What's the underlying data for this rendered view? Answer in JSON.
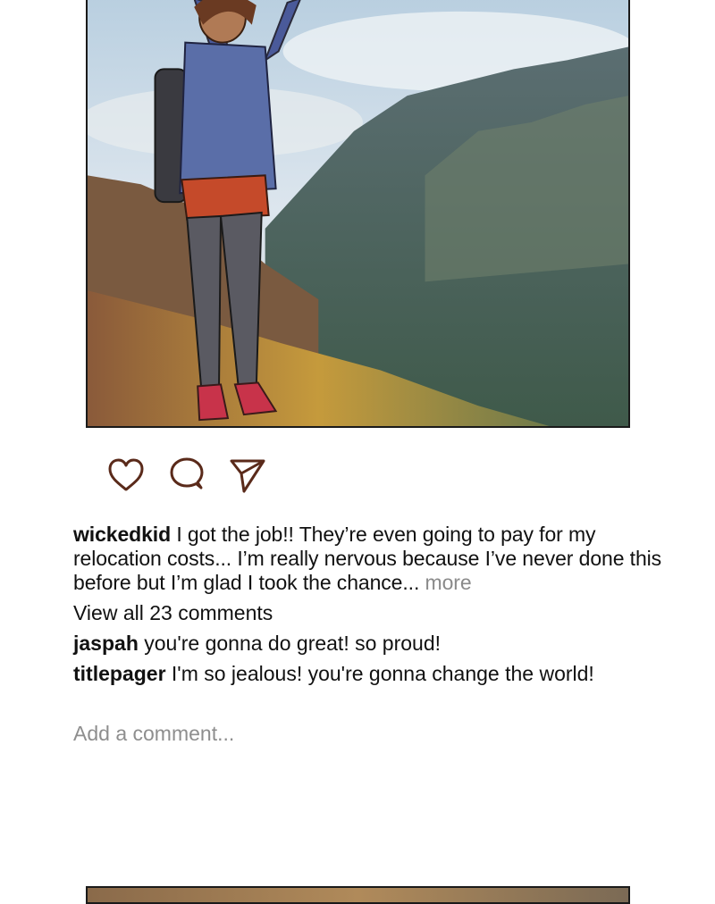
{
  "post": {
    "image_alt": "Illustration of a hiker cheering on a mountain summit",
    "author": "wickedkid",
    "caption_text": " I got the job!! They’re even going to pay for my relocation costs... I’m really nervous because I’ve never done this before but I’m glad I took the chance...",
    "more_label": " more",
    "actions": {
      "like_icon": "heart-outline-icon",
      "comment_icon": "speech-bubble-icon",
      "share_icon": "paper-plane-icon",
      "icon_color": "#5a2a1a"
    }
  },
  "comments": {
    "view_all_label": "View all 23 comments",
    "items": [
      {
        "user": "jaspah",
        "text": " you're gonna do great! so proud!"
      },
      {
        "user": "titlepager",
        "text": " I'm so jealous! you're gonna change the world!"
      }
    ]
  },
  "add_comment": {
    "placeholder": "Add a comment..."
  }
}
